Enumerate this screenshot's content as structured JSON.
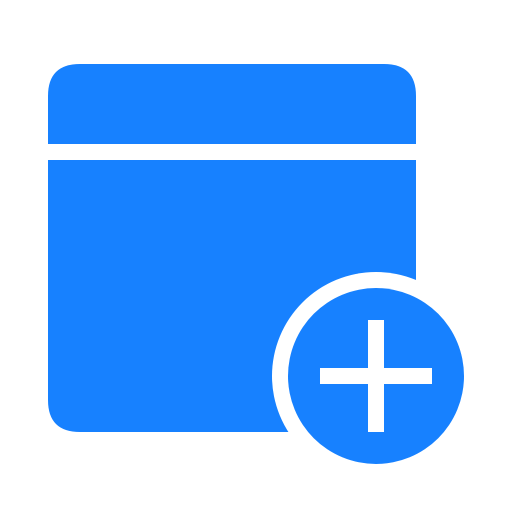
{
  "icon": {
    "name": "add-window-icon",
    "glyph_base": "window-icon",
    "glyph_badge": "plus-badge-icon",
    "colors": {
      "primary": "#1781FF",
      "background": "#FFFFFF",
      "accent_stroke": "#FFFFFF"
    }
  }
}
